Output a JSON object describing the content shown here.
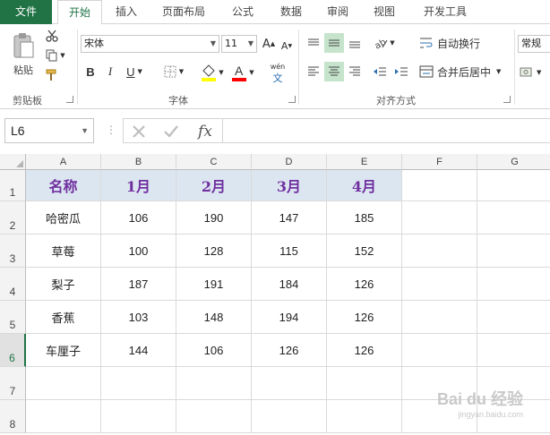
{
  "ribbon_tabs": [
    "文件",
    "开始",
    "插入",
    "页面布局",
    "公式",
    "数据",
    "审阅",
    "视图",
    "开发工具"
  ],
  "active_tab": "开始",
  "clipboard": {
    "paste_label": "粘贴",
    "group_label": "剪贴板"
  },
  "font": {
    "name": "宋体",
    "size": "11",
    "group_label": "字体",
    "bold": "B",
    "italic": "I",
    "underline": "U",
    "grow": "A",
    "shrink": "A",
    "phonetic": "wén"
  },
  "alignment": {
    "group_label": "对齐方式",
    "wrap_label": "自动换行",
    "merge_label": "合并后居中"
  },
  "number_format": {
    "value": "常规"
  },
  "formula_bar": {
    "name_box": "L6",
    "fx_label": "fx",
    "formula": ""
  },
  "colors": {
    "accent": "#217346",
    "header_fill": "#dce6f1",
    "header_text": "#7030a0",
    "fill_color_bar": "#ffff00",
    "font_color_bar": "#ff0000"
  },
  "columns": [
    "A",
    "B",
    "C",
    "D",
    "E",
    "F",
    "G"
  ],
  "row_numbers": [
    "1",
    "2",
    "3",
    "4",
    "5",
    "6",
    "7",
    "8"
  ],
  "active_row": "6",
  "sheet": {
    "header": [
      "名称",
      "1月",
      "2月",
      "3月",
      "4月"
    ],
    "rows": [
      [
        "哈密瓜",
        "106",
        "190",
        "147",
        "185"
      ],
      [
        "草莓",
        "100",
        "128",
        "115",
        "152"
      ],
      [
        "梨子",
        "187",
        "191",
        "184",
        "126"
      ],
      [
        "香蕉",
        "103",
        "148",
        "194",
        "126"
      ],
      [
        "车厘子",
        "144",
        "106",
        "126",
        "126"
      ]
    ]
  },
  "watermark": {
    "brand": "Bai du 经验",
    "url": "jingyan.baidu.com"
  }
}
